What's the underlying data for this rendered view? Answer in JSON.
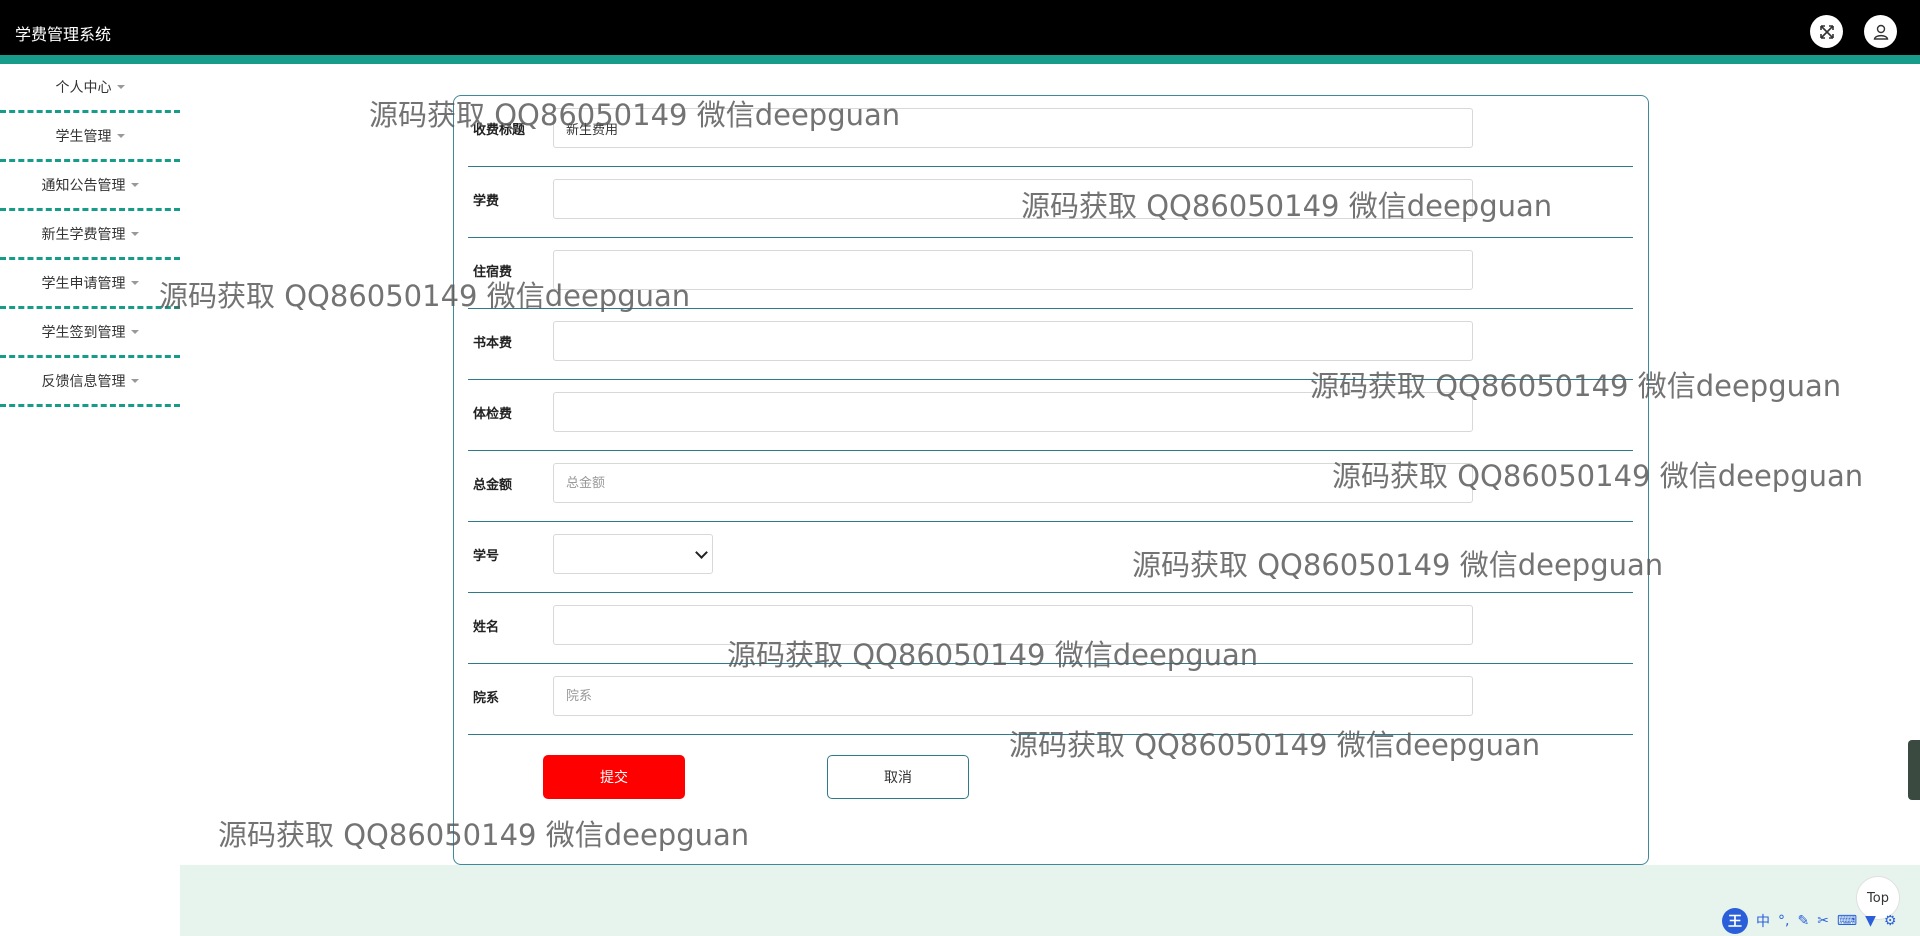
{
  "app": {
    "title": "学费管理系统"
  },
  "header": {
    "icons": [
      "fullscreen-icon",
      "user-icon"
    ]
  },
  "sidebar": {
    "items": [
      {
        "label": "个人中心"
      },
      {
        "label": "学生管理"
      },
      {
        "label": "通知公告管理"
      },
      {
        "label": "新生学费管理"
      },
      {
        "label": "学生申请管理"
      },
      {
        "label": "学生签到管理"
      },
      {
        "label": "反馈信息管理"
      }
    ]
  },
  "form": {
    "title_label": "收费标题",
    "title_value": "新生费用",
    "tuition_label": "学费",
    "tuition_value": "",
    "lodging_label": "住宿费",
    "lodging_value": "",
    "books_label": "书本费",
    "books_value": "",
    "medical_label": "体检费",
    "medical_value": "",
    "total_label": "总金额",
    "total_placeholder": "总金额",
    "student_id_label": "学号",
    "student_id_value": "",
    "name_label": "姓名",
    "name_value": "",
    "department_label": "院系",
    "department_placeholder": "院系"
  },
  "buttons": {
    "submit": "提交",
    "cancel": "取消"
  },
  "watermark": {
    "text": "源码获取 QQ86050149 微信deepguan"
  },
  "misc": {
    "top_label": "Top",
    "ime_logo": "王",
    "ime_mode": "中"
  },
  "colors": {
    "header": "#000000",
    "accent": "#179c8a",
    "submit": "#ff0000",
    "footer": "#e7f4ee"
  }
}
